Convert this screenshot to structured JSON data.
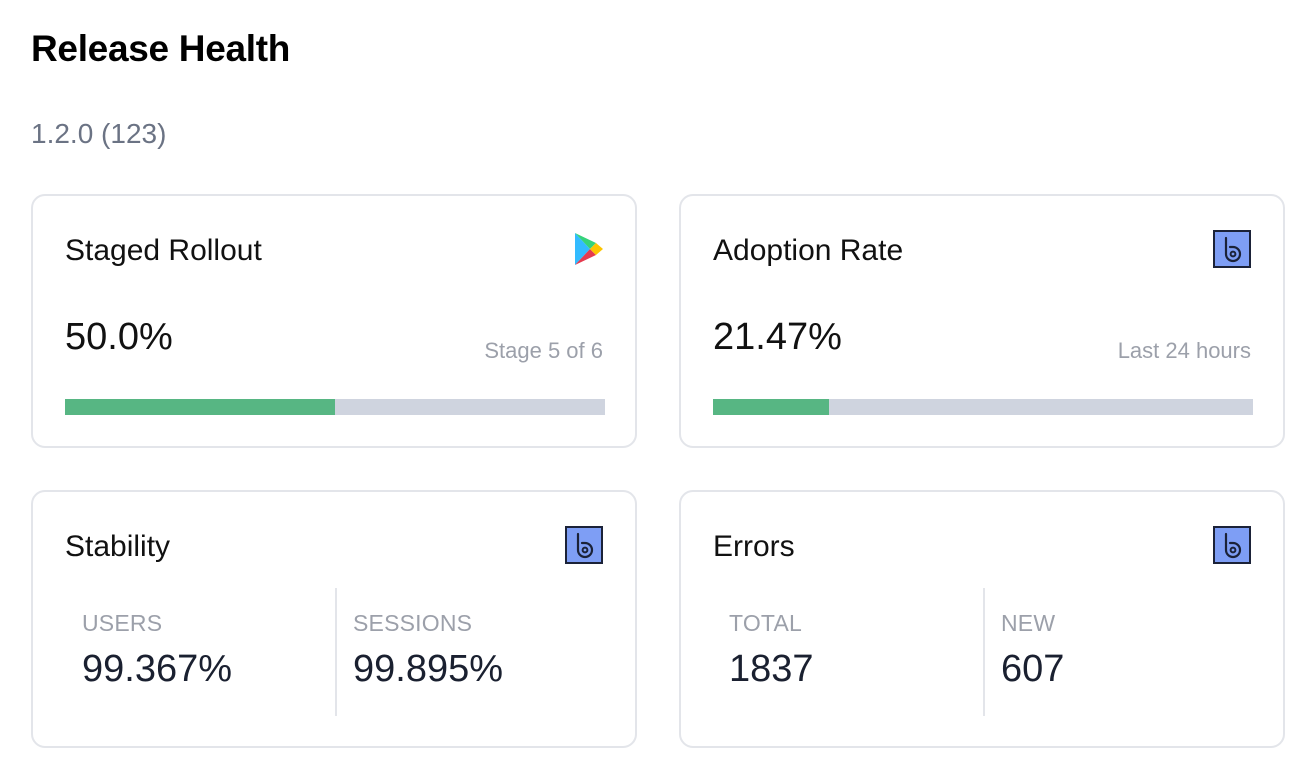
{
  "header": {
    "title": "Release Health",
    "version": "1.2.0 (123)"
  },
  "cards": {
    "staged_rollout": {
      "title": "Staged Rollout",
      "icon": "google-play-icon",
      "value": "50.0%",
      "caption": "Stage 5 of 6",
      "progress_fraction": 0.5
    },
    "adoption_rate": {
      "title": "Adoption Rate",
      "icon": "bugsnag-icon",
      "value": "21.47%",
      "caption": "Last 24 hours",
      "progress_fraction": 0.2147
    },
    "stability": {
      "title": "Stability",
      "icon": "bugsnag-icon",
      "stats": [
        {
          "label": "USERS",
          "value": "99.367%"
        },
        {
          "label": "SESSIONS",
          "value": "99.895%"
        }
      ]
    },
    "errors": {
      "title": "Errors",
      "icon": "bugsnag-icon",
      "stats": [
        {
          "label": "TOTAL",
          "value": "1837"
        },
        {
          "label": "NEW",
          "value": "607"
        }
      ]
    }
  },
  "colors": {
    "progress_fill": "#57b683",
    "progress_track": "#cfd4df",
    "bugsnag_icon_bg": "#7e9ef5"
  }
}
